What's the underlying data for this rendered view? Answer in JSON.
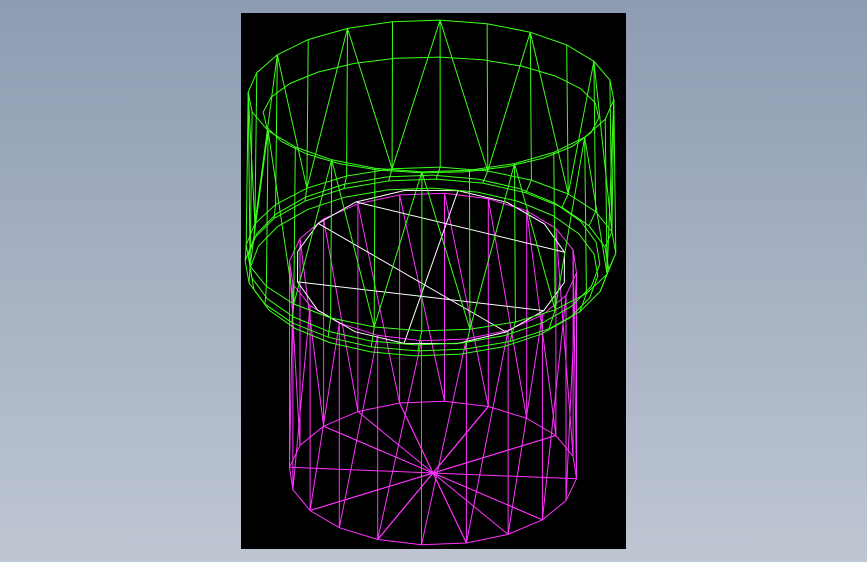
{
  "app": {
    "background_top": "#8e9cb2",
    "background_bottom": "#bec6d2"
  },
  "viewport": {
    "background": "#000000",
    "model_colors": {
      "outer_shell": "#3cff1a",
      "inner_cylinder": "#ff33ff",
      "inner_top_edge": "#ffffff"
    },
    "display_mode": "wireframe"
  }
}
